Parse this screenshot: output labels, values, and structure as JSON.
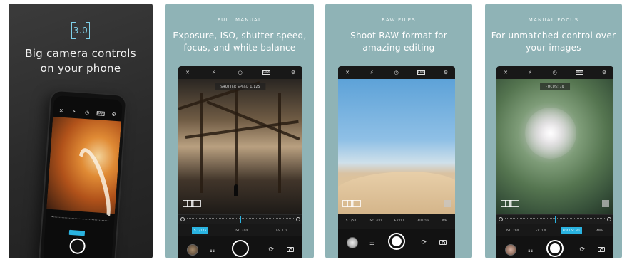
{
  "panel1": {
    "logo_text": "3.0",
    "headline": [
      "Big camera controls",
      "on your phone"
    ],
    "active_param": "3.0s"
  },
  "panel2": {
    "kicker": "FULL MANUAL",
    "headline": "Exposure, ISO, shutter speed, focus, and white balance",
    "badge": "SHUTTER SPEED 1/125",
    "params": [
      "S 1/125",
      "ISO 200",
      "EV 0.0"
    ],
    "active_index": 0
  },
  "panel3": {
    "kicker": "RAW FILES",
    "headline": "Shoot RAW format for amazing editing",
    "params": [
      "S 1/50",
      "ISO 200",
      "EV 0.0",
      "AUTO F",
      "WB"
    ],
    "active_index": -1
  },
  "panel4": {
    "kicker": "MANUAL FOCUS",
    "headline": "For unmatched control over your images",
    "badge": "FOCUS: 30",
    "params": [
      "ISO 200",
      "EV 0.0",
      "FOCUS: 30",
      "AWB"
    ],
    "active_index": 2
  },
  "colors": {
    "teal_bg": "#8fb3b6",
    "accent": "#2ab3e0",
    "dark_bg": "#2a2a2a"
  },
  "icons": {
    "topbar": [
      "flash-off-icon",
      "focus-off-icon",
      "timer-icon",
      "raw-icon",
      "settings-icon"
    ],
    "bottom": [
      "gallery-thumbnail",
      "grid-icon",
      "shutter-button",
      "switch-camera-icon",
      "camera-mode-icon"
    ]
  }
}
